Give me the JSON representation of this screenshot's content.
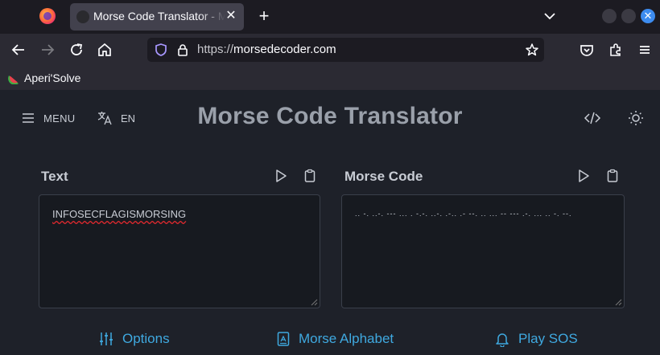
{
  "browser": {
    "tab_title": "Morse Code Translator - Mor",
    "url_host": "https://",
    "url_domain": "morsedecoder.com",
    "bookmark": "Aperi'Solve"
  },
  "header": {
    "menu_label": "MENU",
    "lang_label": "EN",
    "title": "Morse Code Translator"
  },
  "panes": {
    "text_label": "Text",
    "text_value": "INFOSECFLAGISMORSING",
    "morse_label": "Morse Code",
    "morse_value": ".. -. ..-. --- ... . -.-. ..-. .-.. .- --. .. ... -- --- .-. ... .. -. --."
  },
  "footer": {
    "options": "Options",
    "alphabet": "Morse Alphabet",
    "sos": "Play SOS"
  },
  "colors": {
    "accent": "#3fa9e0",
    "background": "#1e2129",
    "title": "#9aa0aa"
  }
}
